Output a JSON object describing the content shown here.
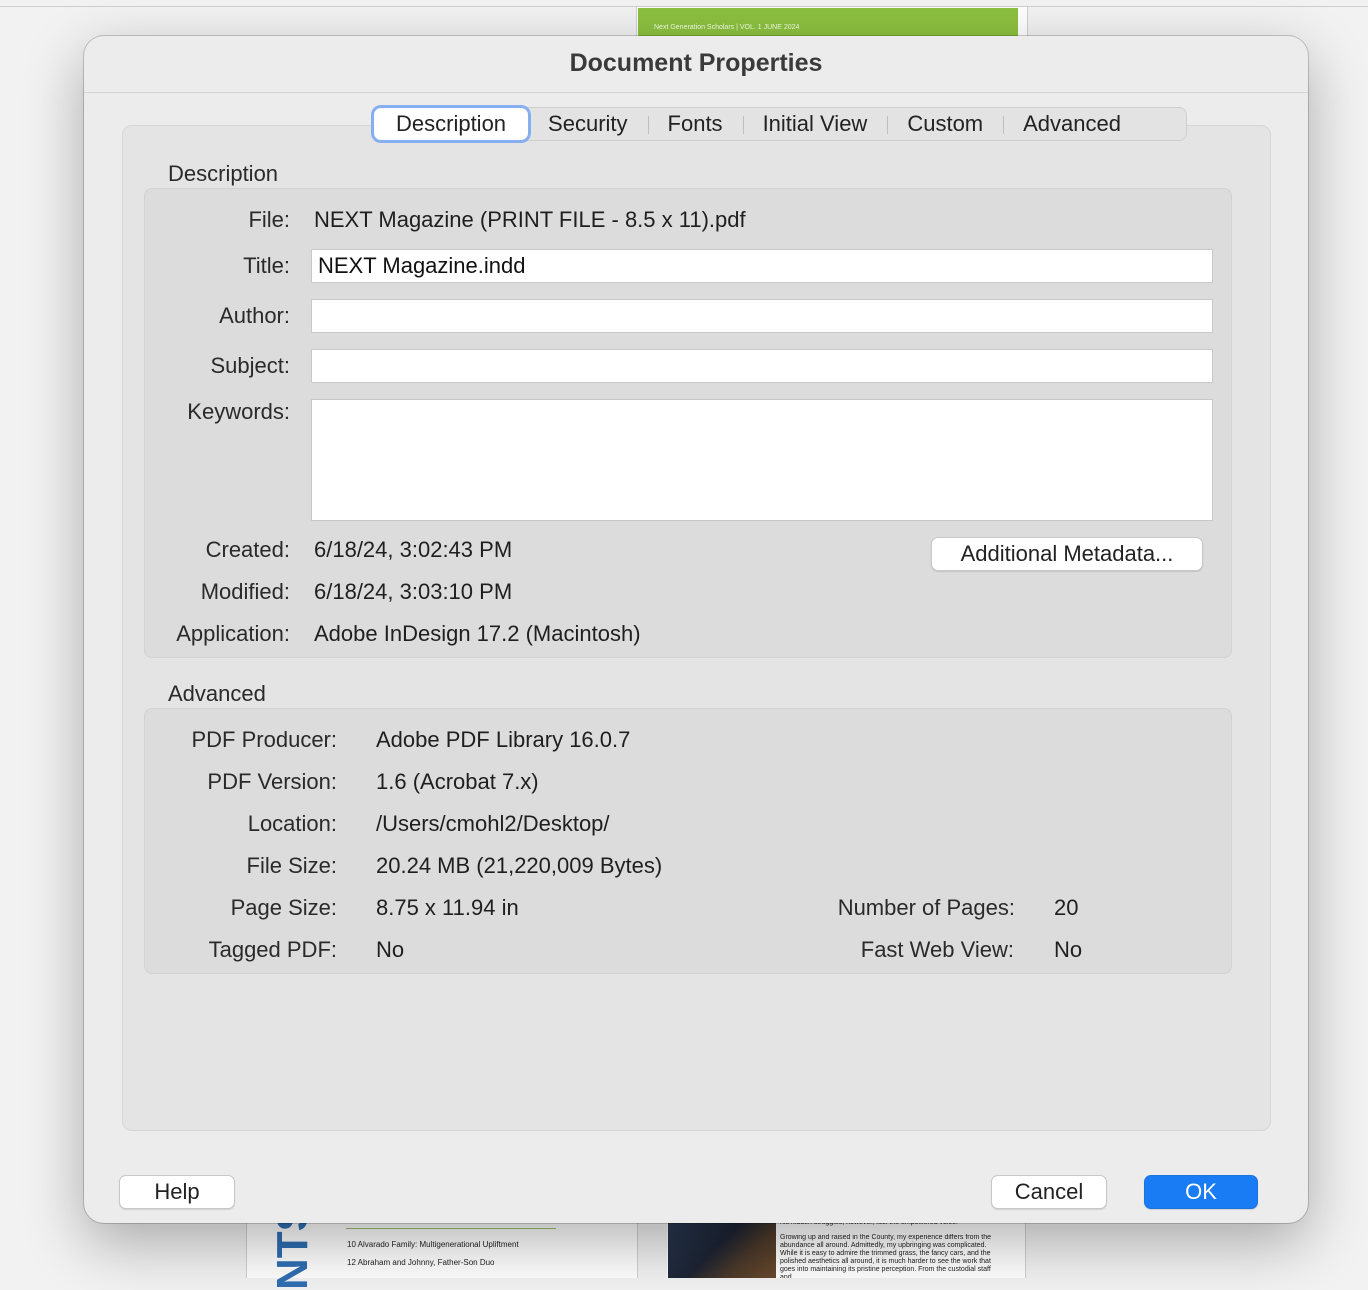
{
  "background": {
    "header_strip": "Next Generation Scholars | VOL. 1 JUNE 2024",
    "vertical_word": "NTS",
    "toc": [
      "10  Alvarado Family: Multigenerational Upliftment",
      "12  Abraham and Johnny, Father-Son Duo"
    ],
    "para_top": "his hidden struggles, however, fuel the empowered voice.",
    "para": "Growing up and raised in the County, my experience differs from the abundance all around. Admittedly, my upbringing was complicated. While it is easy to admire the trimmed grass, the fancy cars, and the polished aesthetics all around, it is much harder to see the work that goes into maintaining its pristine perception. From the custodial staff and"
  },
  "dialog": {
    "title": "Document Properties",
    "tabs": [
      "Description",
      "Security",
      "Fonts",
      "Initial View",
      "Custom",
      "Advanced"
    ],
    "active_tab": "Description",
    "description": {
      "section_label": "Description",
      "file_label": "File:",
      "file_value": "NEXT Magazine (PRINT FILE - 8.5 x 11).pdf",
      "title_label": "Title:",
      "title_value": "NEXT Magazine.indd",
      "author_label": "Author:",
      "author_value": "",
      "subject_label": "Subject:",
      "subject_value": "",
      "keywords_label": "Keywords:",
      "keywords_value": "",
      "created_label": "Created:",
      "created_value": "6/18/24, 3:02:43 PM",
      "modified_label": "Modified:",
      "modified_value": "6/18/24, 3:03:10 PM",
      "application_label": "Application:",
      "application_value": "Adobe InDesign 17.2 (Macintosh)",
      "metadata_button": "Additional Metadata..."
    },
    "advanced": {
      "section_label": "Advanced",
      "producer_label": "PDF Producer:",
      "producer_value": "Adobe PDF Library 16.0.7",
      "version_label": "PDF Version:",
      "version_value": "1.6 (Acrobat 7.x)",
      "location_label": "Location:",
      "location_value": "/Users/cmohl2/Desktop/",
      "filesize_label": "File Size:",
      "filesize_value": "20.24 MB (21,220,009 Bytes)",
      "pagesize_label": "Page Size:",
      "pagesize_value": "8.75 x 11.94 in",
      "pages_label": "Number of Pages:",
      "pages_value": "20",
      "tagged_label": "Tagged PDF:",
      "tagged_value": "No",
      "fastweb_label": "Fast Web View:",
      "fastweb_value": "No"
    },
    "buttons": {
      "help": "Help",
      "cancel": "Cancel",
      "ok": "OK"
    },
    "colors": {
      "accent": "#1a7cf5",
      "focus_ring": "#86aef0"
    }
  }
}
